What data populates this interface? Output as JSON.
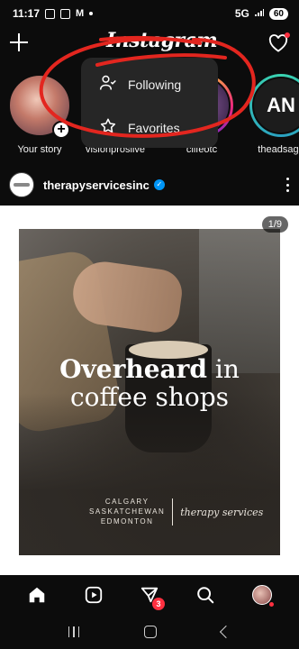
{
  "status_bar": {
    "time": "11:17",
    "network": "5G",
    "battery": "60"
  },
  "header": {
    "logo": "Instagram",
    "dropdown": [
      {
        "label": "Following",
        "icon": "following-icon"
      },
      {
        "label": "Favorites",
        "icon": "star-icon"
      }
    ]
  },
  "stories": [
    {
      "name": "Your story"
    },
    {
      "name": "visionprosllve"
    },
    {
      "name": "cllfeotc"
    },
    {
      "name": "theadsage"
    }
  ],
  "post": {
    "username": "therapyservicesinc",
    "verified": true,
    "counter": "1/9",
    "headline_bold": "Overheard",
    "headline_rest": " in",
    "headline_line2": "coffee shops",
    "cities": [
      "CALGARY",
      "SASKATCHEWAN",
      "EDMONTON"
    ],
    "brand_script": "therapy services"
  },
  "bottom_nav": {
    "messages_badge": "3"
  },
  "colors": {
    "background": "#0c0c0c",
    "dropdown": "#262626",
    "badge": "#ff3040",
    "verified": "#0095f6",
    "annotation": "#e3261f"
  }
}
